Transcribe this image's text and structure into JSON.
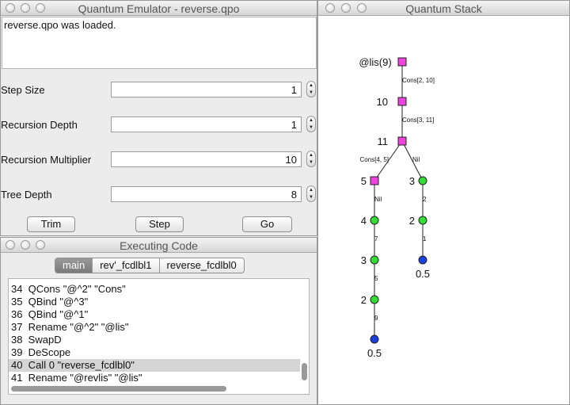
{
  "emulator": {
    "title": "Quantum Emulator - reverse.qpo",
    "status": "reverse.qpo was loaded.",
    "params": [
      {
        "label": "Step Size",
        "value": "1"
      },
      {
        "label": "Recursion Depth",
        "value": "1"
      },
      {
        "label": "Recursion Multiplier",
        "value": "10"
      },
      {
        "label": "Tree Depth",
        "value": "8"
      }
    ],
    "buttons": {
      "trim": "Trim",
      "step": "Step",
      "go": "Go"
    }
  },
  "executing": {
    "title": "Executing Code",
    "tabs": [
      "main",
      "rev'_fcdlbl1",
      "reverse_fcdlbl0"
    ],
    "active_tab": "main",
    "lines": [
      "34  QCons \"@^2\" \"Cons\"",
      "35  QBind \"@^3\"",
      "36  QBind \"@^1\"",
      "37  Rename \"@^2\" \"@lis\"",
      "38  SwapD",
      "39  DeScope",
      "40  Call 0 \"reverse_fcdlbl0\"",
      "41  Rename \"@revlis\" \"@lis\""
    ],
    "selected_line": 6
  },
  "stack": {
    "title": "Quantum Stack",
    "node_colors": {
      "square": "#ee44dd",
      "circle": "#33dd33",
      "leaf": "#1a3fe0"
    },
    "nodes": [
      {
        "id": "n1",
        "shape": "square",
        "label": "@lis(9)"
      },
      {
        "id": "n2",
        "shape": "square",
        "label": "10"
      },
      {
        "id": "n3",
        "shape": "square",
        "label": "11"
      },
      {
        "id": "n4",
        "shape": "square",
        "label": "5"
      },
      {
        "id": "n5",
        "shape": "circle",
        "label": "3"
      },
      {
        "id": "n6",
        "shape": "circle",
        "label": "4"
      },
      {
        "id": "n7",
        "shape": "circle",
        "label": "2"
      },
      {
        "id": "n8",
        "shape": "circle",
        "label": "3"
      },
      {
        "id": "n9",
        "shape": "leaf",
        "label": "0.5"
      },
      {
        "id": "n10",
        "shape": "circle",
        "label": "2"
      },
      {
        "id": "n11",
        "shape": "leaf",
        "label": "0.5"
      }
    ],
    "edges": [
      {
        "from": "n1",
        "to": "n2",
        "label": "Cons[2, 10]"
      },
      {
        "from": "n2",
        "to": "n3",
        "label": "Cons[3, 11]"
      },
      {
        "from": "n3",
        "to": "n4",
        "label": "Cons[4, 5]"
      },
      {
        "from": "n3",
        "to": "n5",
        "label": "Nil"
      },
      {
        "from": "n4",
        "to": "n6",
        "label": "Nil"
      },
      {
        "from": "n5",
        "to": "n7",
        "label": "2"
      },
      {
        "from": "n6",
        "to": "n8",
        "label": "7"
      },
      {
        "from": "n7",
        "to": "n9",
        "label": "1"
      },
      {
        "from": "n8",
        "to": "n10",
        "label": "5"
      },
      {
        "from": "n10",
        "to": "n11",
        "label": "9"
      }
    ]
  }
}
